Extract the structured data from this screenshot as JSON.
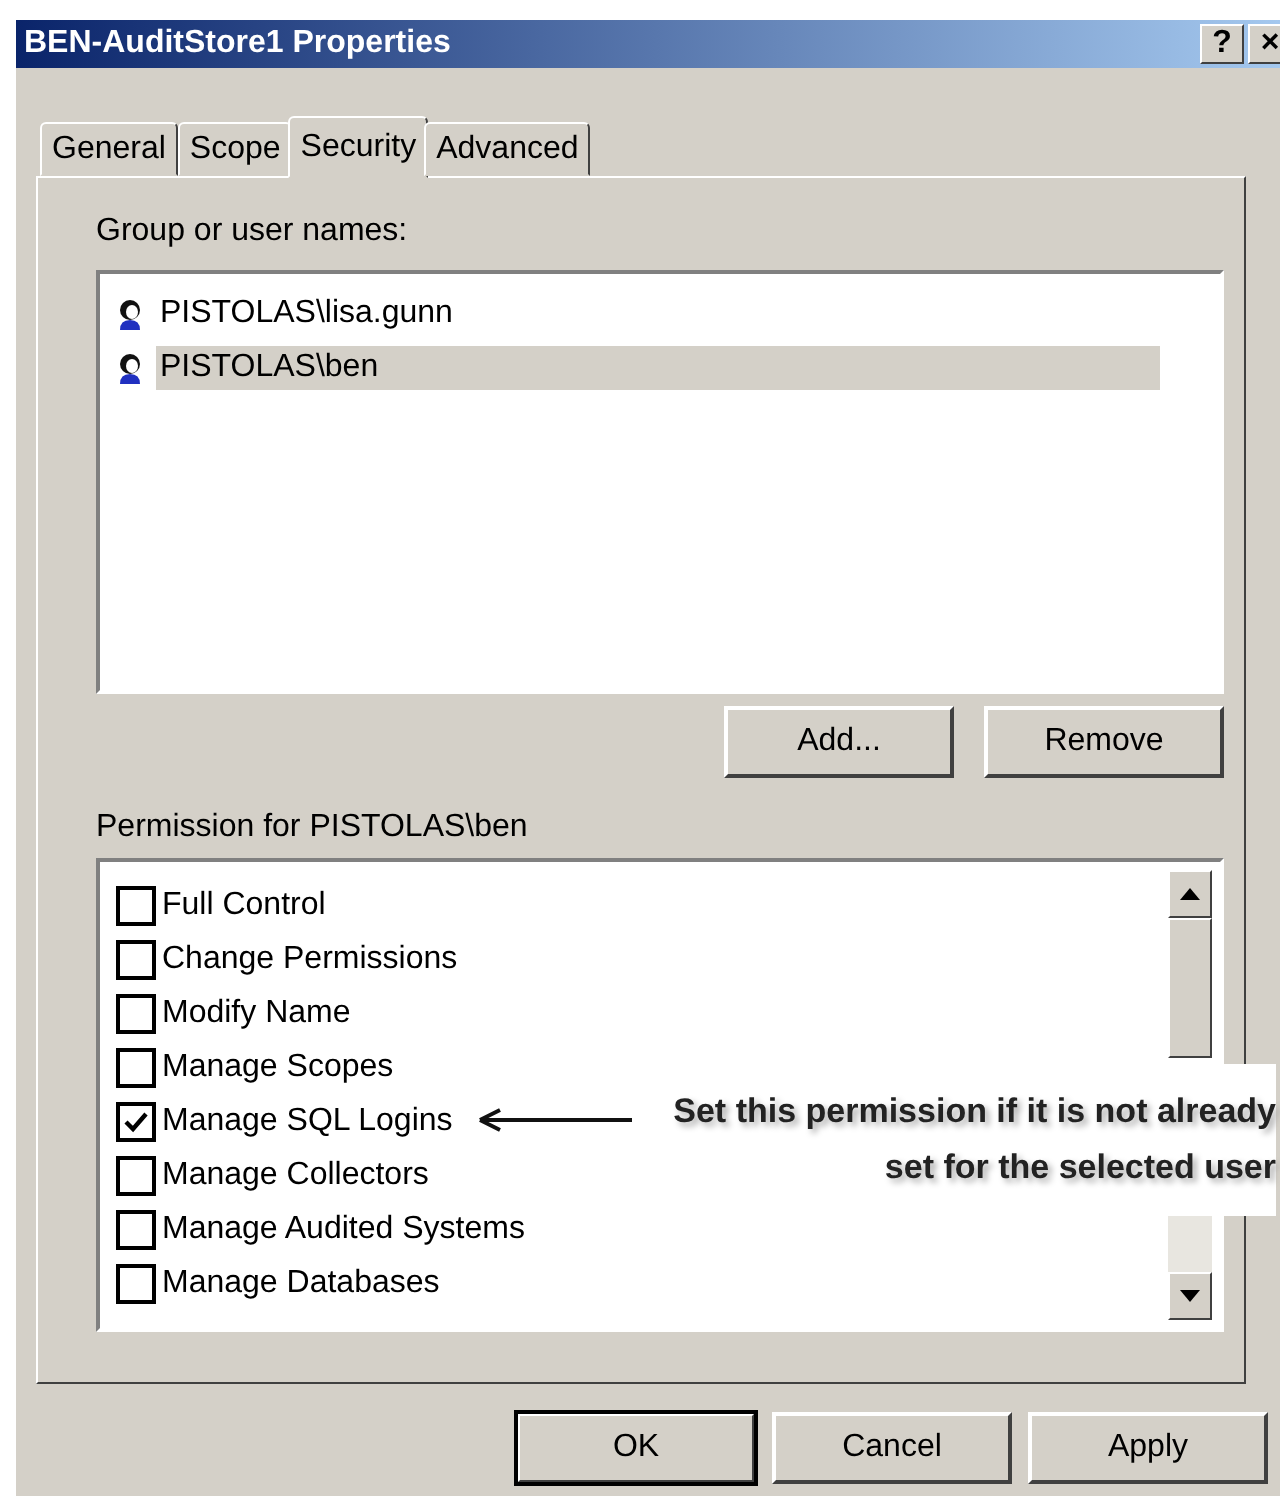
{
  "window": {
    "title": "BEN-AuditStore1 Properties",
    "help_button": "?",
    "close_button": "×"
  },
  "tabs": [
    {
      "label": "General",
      "selected": false
    },
    {
      "label": "Scope",
      "selected": false
    },
    {
      "label": "Security",
      "selected": true
    },
    {
      "label": "Advanced",
      "selected": false
    }
  ],
  "users": {
    "label": "Group or user names:",
    "items": [
      {
        "name": "PISTOLAS\\lisa.gunn",
        "selected": false
      },
      {
        "name": "PISTOLAS\\ben",
        "selected": true
      }
    ]
  },
  "user_buttons": [
    "Add...",
    "Remove"
  ],
  "permissions": {
    "label": "Permission for PISTOLAS\\ben",
    "items": [
      {
        "name": "Full Control",
        "checked": false
      },
      {
        "name": "Change Permissions",
        "checked": false
      },
      {
        "name": "Modify Name",
        "checked": false
      },
      {
        "name": "Manage Scopes",
        "checked": false
      },
      {
        "name": "Manage SQL Logins",
        "checked": true
      },
      {
        "name": "Manage Collectors",
        "checked": false
      },
      {
        "name": "Manage Audited Systems",
        "checked": false
      },
      {
        "name": "Manage Databases",
        "checked": false
      }
    ]
  },
  "callout": "Set this permission if it is not already set for the selected user",
  "buttons": [
    "OK",
    "Cancel",
    "Apply"
  ]
}
